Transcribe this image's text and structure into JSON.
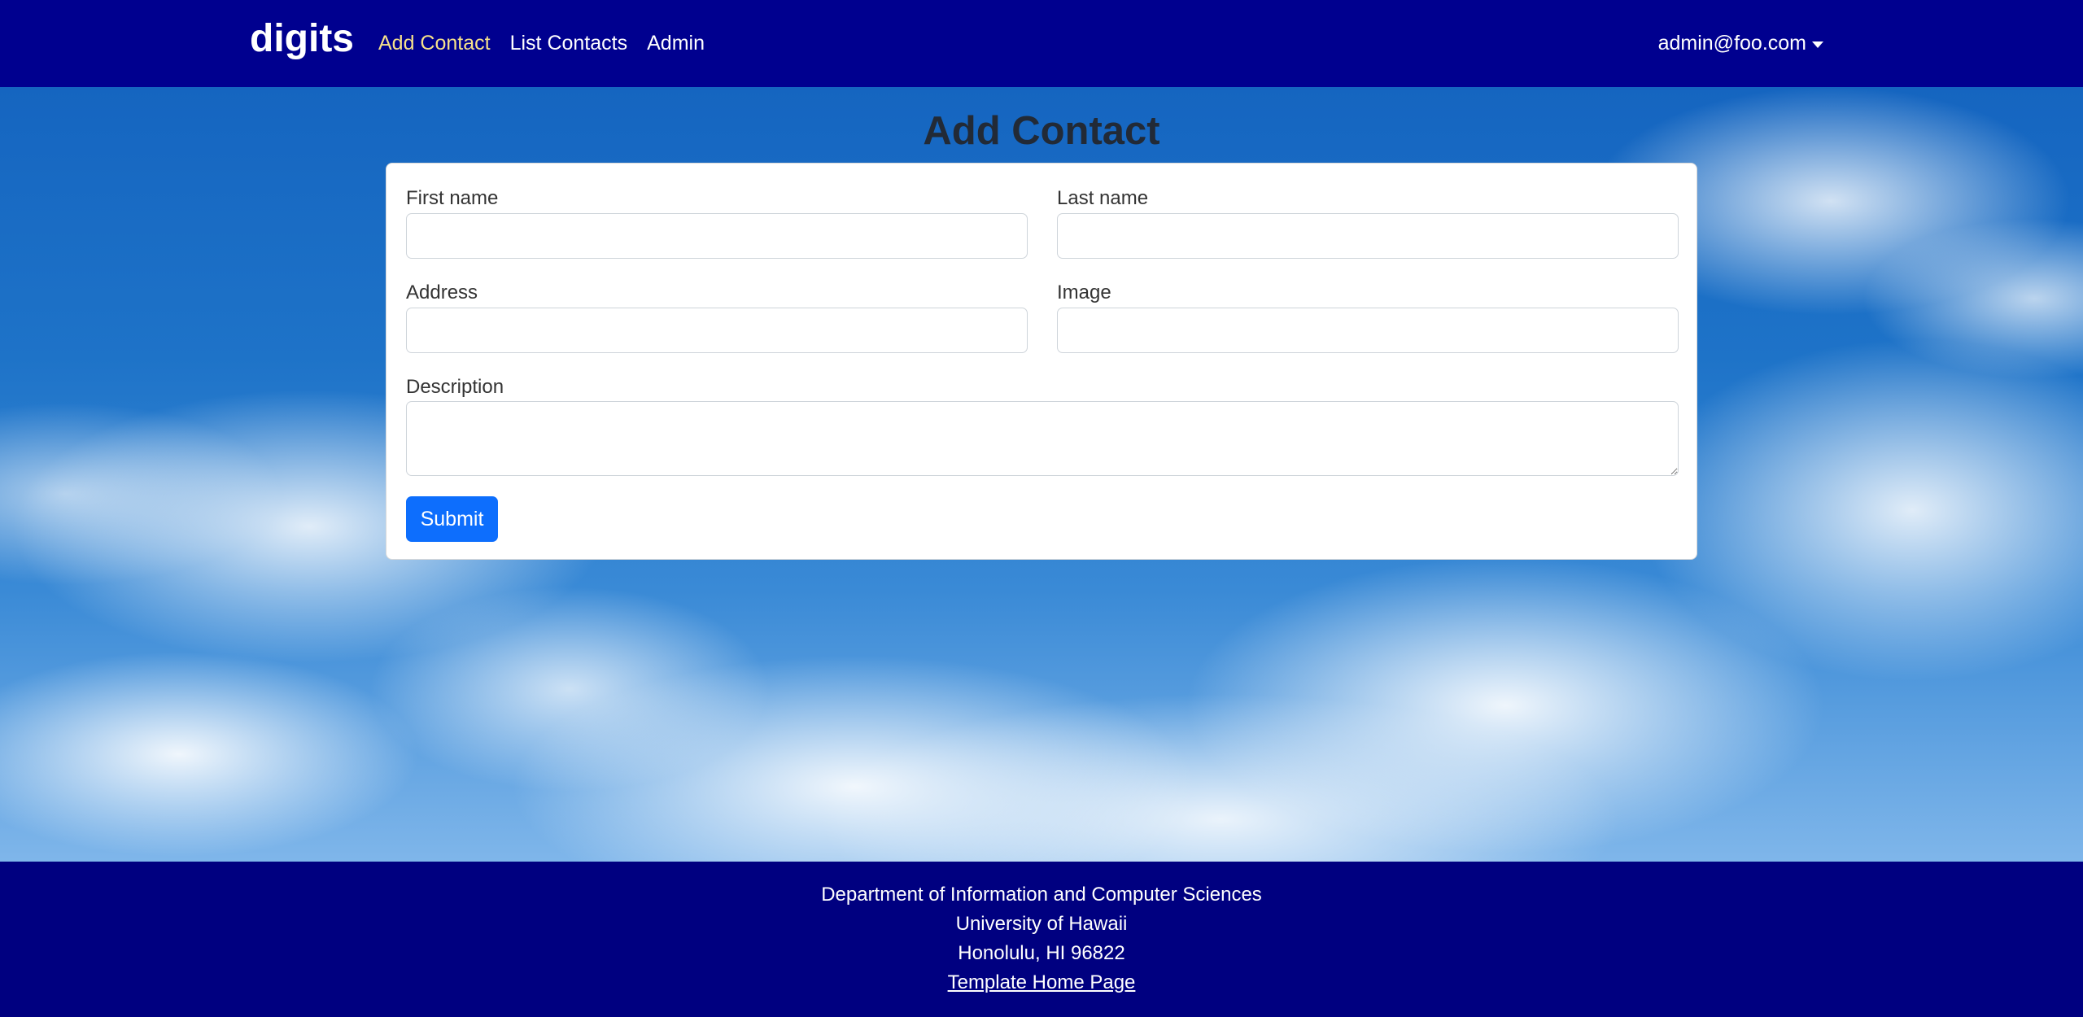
{
  "navbar": {
    "brand": "digits",
    "links": [
      {
        "label": "Add Contact",
        "active": true
      },
      {
        "label": "List Contacts",
        "active": false
      },
      {
        "label": "Admin",
        "active": false
      }
    ],
    "user": "admin@foo.com"
  },
  "page": {
    "title": "Add Contact"
  },
  "form": {
    "first_name": {
      "label": "First name",
      "value": ""
    },
    "last_name": {
      "label": "Last name",
      "value": ""
    },
    "address": {
      "label": "Address",
      "value": ""
    },
    "image": {
      "label": "Image",
      "value": ""
    },
    "description": {
      "label": "Description",
      "value": ""
    },
    "submit_label": "Submit"
  },
  "footer": {
    "line1": "Department of Information and Computer Sciences",
    "line2": "University of Hawaii",
    "line3": "Honolulu, HI 96822",
    "link": "Template Home Page"
  },
  "colors": {
    "navbar_bg": "#00008f",
    "active_link": "#f7e28b",
    "submit_bg": "#0d6efd",
    "footer_bg": "#000080"
  }
}
